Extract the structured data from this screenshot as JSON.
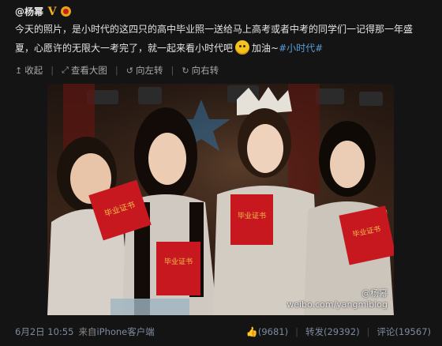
{
  "post": {
    "author": "@杨幂",
    "verified_badge": "V",
    "text_line1": "今天的照片，是小时代的这四只的高中毕业照一送给马上高考或者中考的同学们一记得那一年盛",
    "text_line2_a": "夏，心愿许的无限大一考完了，就一起来看小时代吧",
    "text_line2_b": "加油~",
    "hashtag": "#小时代#"
  },
  "toolbar": {
    "collapse": "收起",
    "view_large": "查看大图",
    "rotate_left": "向左转",
    "rotate_right": "向右转",
    "icons": [
      "collapse-arrow-icon",
      "expand-image-icon",
      "rotate-left-icon",
      "rotate-right-icon"
    ]
  },
  "photo": {
    "watermark_user": "@杨幂",
    "watermark_url": "weibo.com/yangmiblog",
    "certificate_text": "毕业证书"
  },
  "footer": {
    "date": "6月2日 10:55",
    "source_prefix": "来自",
    "source": "iPhone客户端",
    "likes": "(9681)",
    "repost": "转发(29392)",
    "comment": "评论(19567)"
  },
  "colors": {
    "background": "#141414",
    "link": "#7d8ba0",
    "hashtag": "#5b9bd5",
    "badge": "#f3b21b"
  }
}
